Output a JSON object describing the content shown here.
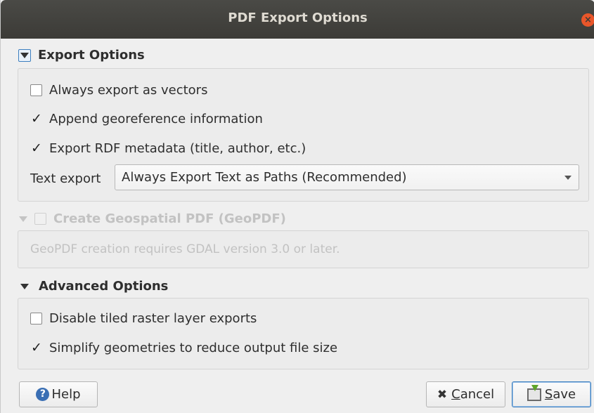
{
  "window": {
    "title": "PDF Export Options",
    "close_glyph": "×"
  },
  "export_options": {
    "header": "Export Options",
    "always_vectors": {
      "label": "Always export as vectors",
      "checked": false
    },
    "georeference": {
      "label": "Append georeference information",
      "checked": true
    },
    "rdf_metadata": {
      "label": "Export RDF metadata (title, author, etc.)",
      "checked": true
    },
    "text_export": {
      "label": "Text export",
      "value": "Always Export Text as Paths (Recommended)"
    }
  },
  "geopdf": {
    "header": "Create Geospatial PDF (GeoPDF)",
    "checked": false,
    "enabled": false,
    "message": "GeoPDF creation requires GDAL version 3.0 or later."
  },
  "advanced_options": {
    "header": "Advanced Options",
    "disable_tiled": {
      "label": "Disable tiled raster layer exports",
      "checked": false
    },
    "simplify": {
      "label": "Simplify geometries to reduce output file size",
      "checked": true
    }
  },
  "buttons": {
    "help": {
      "label": "Help",
      "icon": "help-icon"
    },
    "cancel": {
      "first": "C",
      "rest": "ancel",
      "icon": "cancel-x-icon"
    },
    "save": {
      "first": "S",
      "rest": "ave",
      "icon": "save-icon"
    }
  },
  "check_glyph": "✓",
  "colors": {
    "titlebar": "#3c3b37",
    "close": "#e9562a",
    "accent": "#3d7fbf"
  }
}
